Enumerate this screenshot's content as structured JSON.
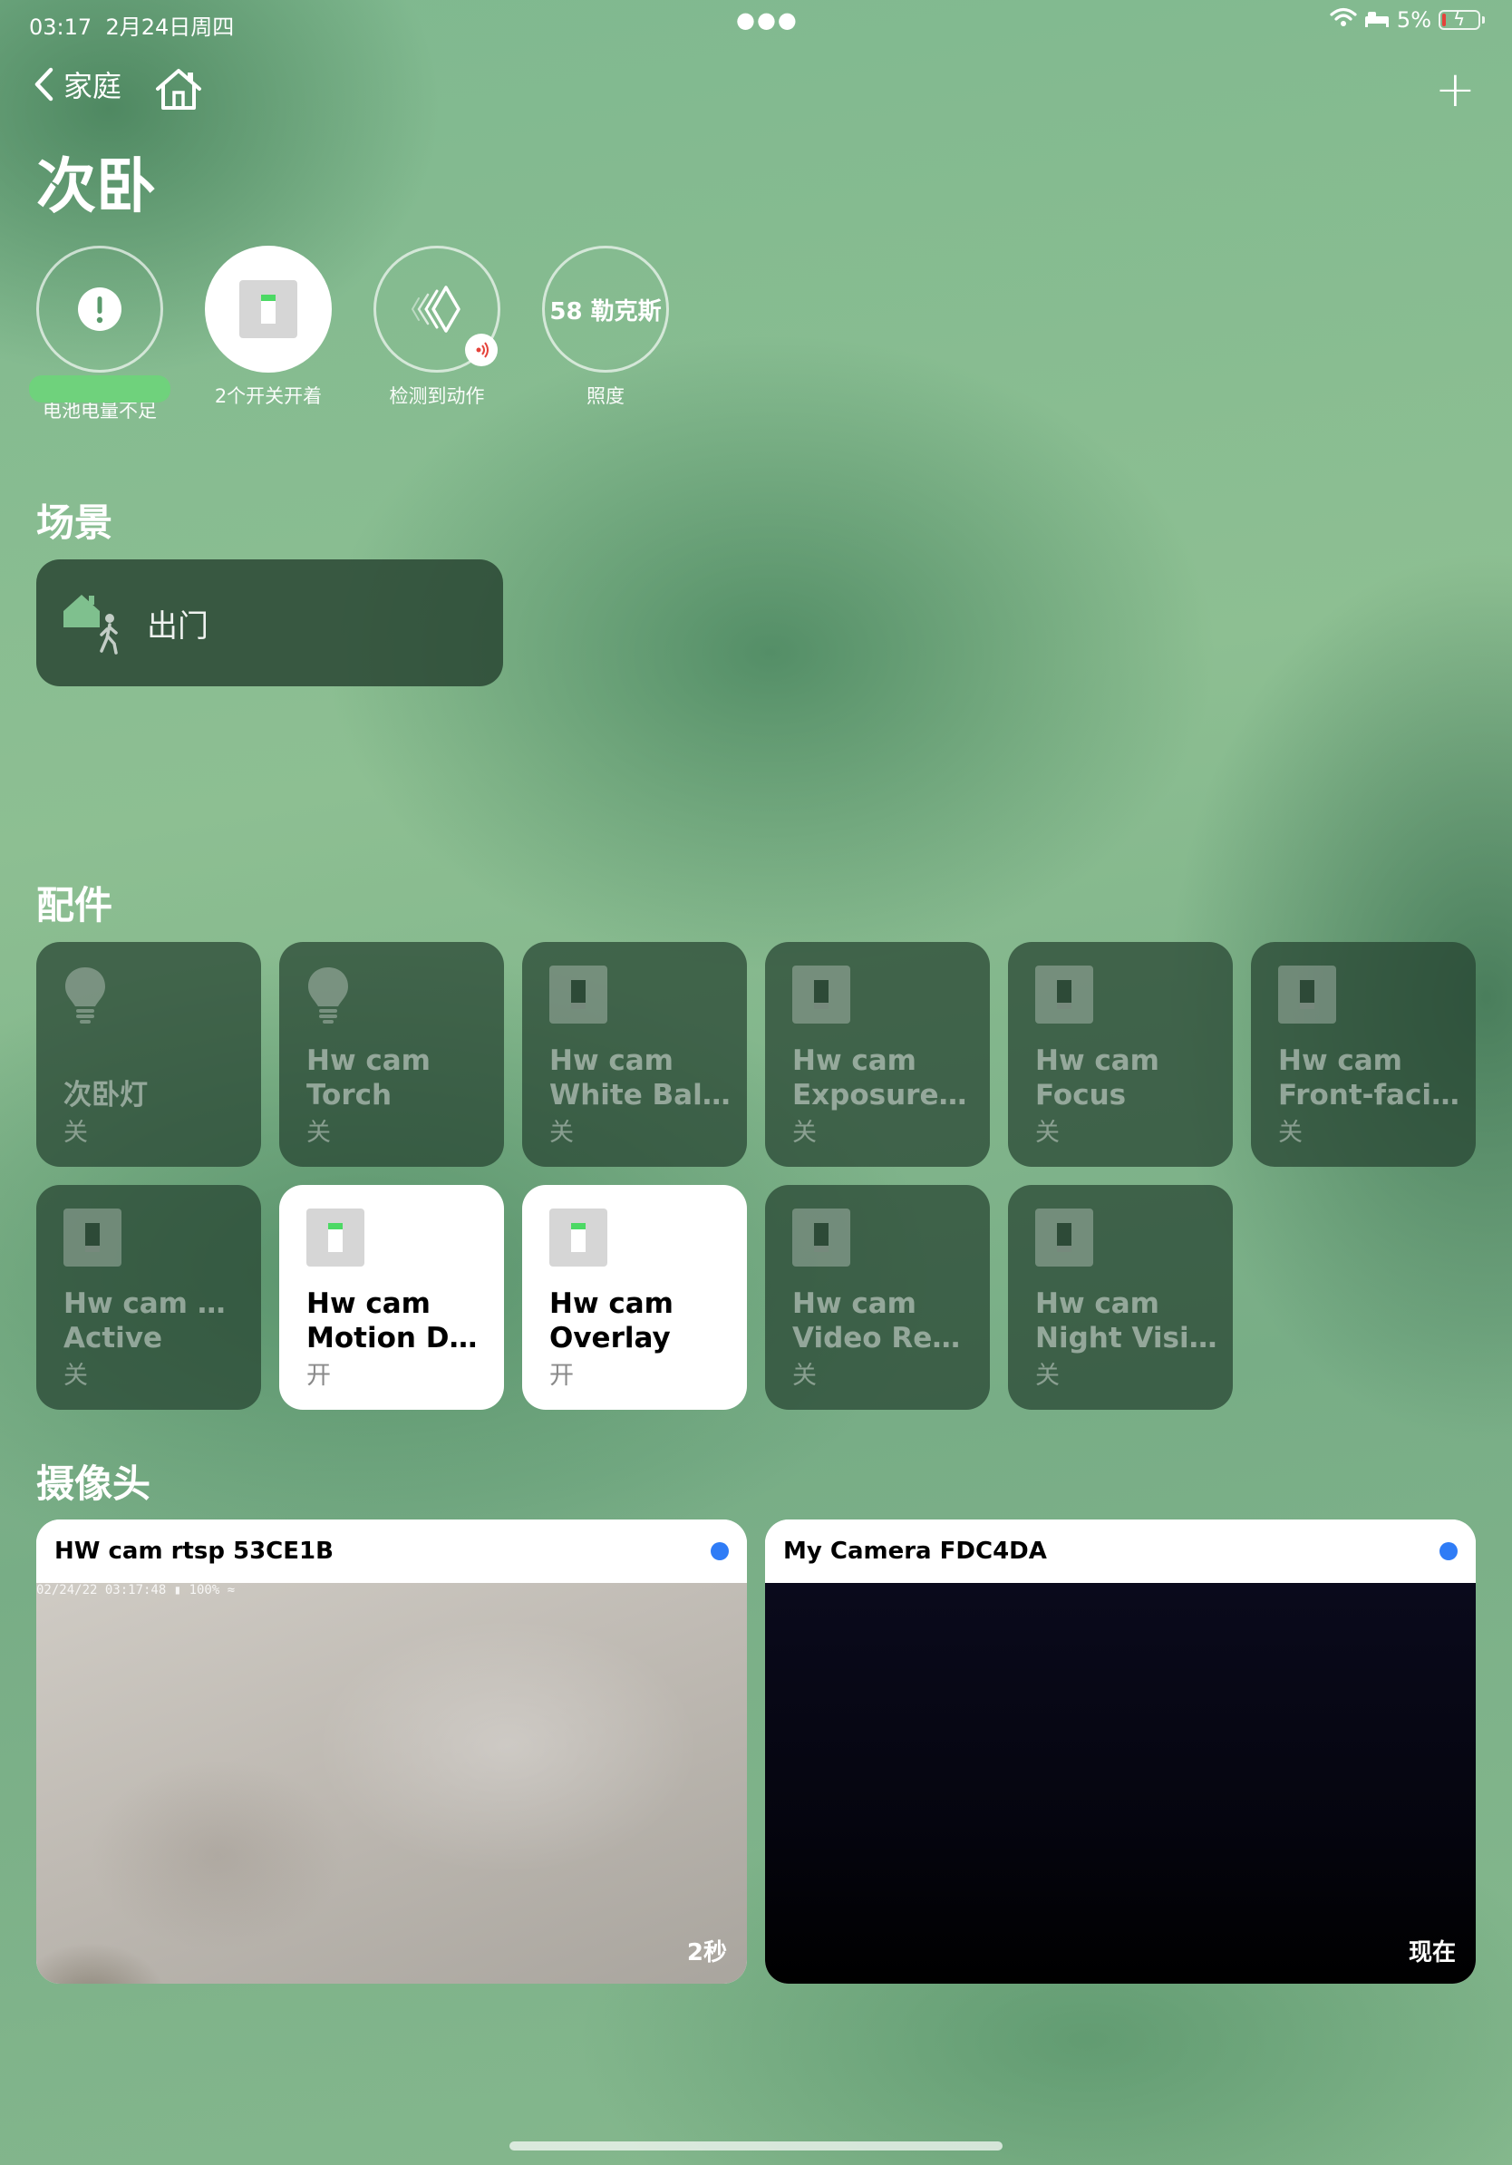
{
  "status_bar": {
    "time": "03:17",
    "date": "2月24日周四",
    "battery_percent": "5%"
  },
  "nav": {
    "back_label": "家庭",
    "add_label": "+"
  },
  "room_title": "次卧",
  "status_items": [
    {
      "label": "电池电量不足",
      "icon": "exclamation-icon"
    },
    {
      "label": "2个开关开着",
      "icon": "switch-icon"
    },
    {
      "label": "检测到动作",
      "icon": "motion-icon"
    },
    {
      "value": "58 勒克斯",
      "label": "照度"
    }
  ],
  "scenes": {
    "title": "场景",
    "items": [
      {
        "label": "出门",
        "icon": "leave-home-icon"
      }
    ]
  },
  "accessories": {
    "title": "配件",
    "items": [
      {
        "name_lines": [
          "次卧灯"
        ],
        "state": "关",
        "icon": "lightbulb-icon",
        "on": false
      },
      {
        "name_lines": [
          "Hw cam",
          "Torch"
        ],
        "state": "关",
        "icon": "lightbulb-icon",
        "on": false
      },
      {
        "name_lines": [
          "Hw cam",
          "White Bala..."
        ],
        "state": "关",
        "icon": "switch-icon",
        "on": false
      },
      {
        "name_lines": [
          "Hw cam",
          "Exposure L..."
        ],
        "state": "关",
        "icon": "switch-icon",
        "on": false
      },
      {
        "name_lines": [
          "Hw cam",
          "Focus"
        ],
        "state": "关",
        "icon": "switch-icon",
        "on": false
      },
      {
        "name_lines": [
          "Hw cam",
          "Front-facin..."
        ],
        "state": "关",
        "icon": "switch-icon",
        "on": false
      },
      {
        "name_lines": [
          "Hw cam GPS",
          "Active"
        ],
        "state": "关",
        "icon": "switch-icon",
        "on": false
      },
      {
        "name_lines": [
          "Hw cam",
          "Motion Det..."
        ],
        "state": "开",
        "icon": "switch-icon",
        "on": true
      },
      {
        "name_lines": [
          "Hw cam",
          "Overlay"
        ],
        "state": "开",
        "icon": "switch-icon",
        "on": true
      },
      {
        "name_lines": [
          "Hw cam",
          "Video Rec..."
        ],
        "state": "关",
        "icon": "switch-icon",
        "on": false
      },
      {
        "name_lines": [
          "Hw cam",
          "Night Vision"
        ],
        "state": "关",
        "icon": "switch-icon",
        "on": false
      }
    ]
  },
  "cameras": {
    "title": "摄像头",
    "items": [
      {
        "name": "HW cam rtsp 53CE1B",
        "osd": "02/24/22 03:17:48 ▮ 100% ≈",
        "age": "2秒",
        "feed": "wall"
      },
      {
        "name": "My Camera FDC4DA",
        "osd": "",
        "age": "现在",
        "feed": "dark"
      }
    ]
  },
  "colors": {
    "tile_off_bg": "#26422f",
    "tile_on_bg": "#ffffff",
    "indicator_on": "#4cd964",
    "live_dot": "#2f7cf6",
    "motion_badge": "#e5423a"
  }
}
